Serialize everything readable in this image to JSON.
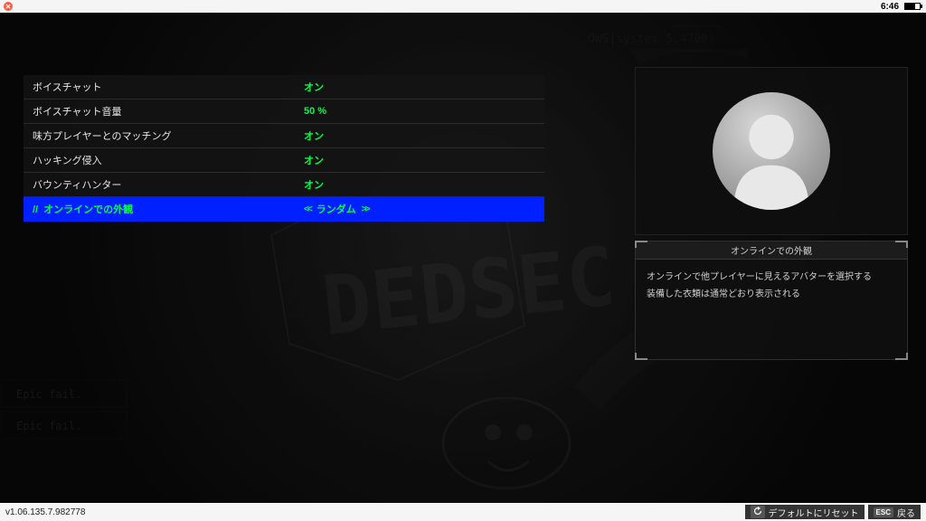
{
  "topbar": {
    "clock": "6:46"
  },
  "menu": {
    "items": [
      {
        "label": "ボイスチャット",
        "value": "オン",
        "selected": false
      },
      {
        "label": "ボイスチャット音量",
        "value": "50 %",
        "selected": false
      },
      {
        "label": "味方プレイヤーとのマッチング",
        "value": "オン",
        "selected": false
      },
      {
        "label": "ハッキング侵入",
        "value": "オン",
        "selected": false
      },
      {
        "label": "バウンティハンター",
        "value": "オン",
        "selected": false
      },
      {
        "label": "オンラインでの外観",
        "value": "ランダム",
        "selected": true,
        "arrows": true
      }
    ]
  },
  "right": {
    "desc_title": "オンラインでの外観",
    "desc_line1": "オンラインで他プレイヤーに見えるアバターを選択する",
    "desc_line2": "装備した衣類は通常どおり表示される"
  },
  "bottom": {
    "version": "v1.06.135.7.982778",
    "reset_label": "デフォルトにリセット",
    "reset_key_icon": "reset",
    "back_label": "戻る",
    "back_key": "ESC"
  },
  "colors": {
    "accent": "#00ff44",
    "select": "#0020ff"
  }
}
